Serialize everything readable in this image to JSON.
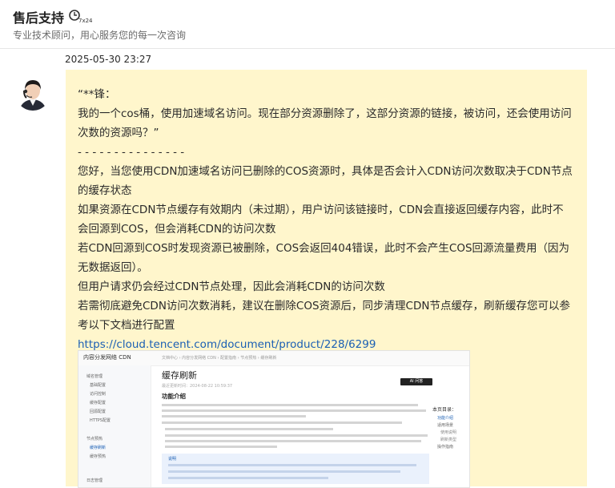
{
  "header": {
    "title": "售后支持",
    "badge_text": "7x24",
    "subtitle": "专业技术顾问，用心服务您的每一次咨询"
  },
  "message": {
    "timestamp": "2025-05-30 23:27",
    "lines": [
      "“**锋：",
      "我的一个cos桶，使用加速域名访问。现在部分资源删除了，这部分资源的链接，被访问，还会使用访问次数的资源吗？”",
      "- - - - - - - - - - - - - - -",
      "您好，当您使用CDN加速域名访问已删除的COS资源时，具体是否会计入CDN访问次数取决于CDN节点的缓存状态",
      "如果资源在CDN节点缓存有效期内（未过期），用户访问该链接时，CDN会直接返回缓存内容，此时不会回源到COS，但会消耗CDN的访问次数",
      "若CDN回源到COS时发现资源已被删除，COS会返回404错误，此时不会产生COS回源流量费用（因为无数据返回）。",
      "但用户请求仍会经过CDN节点处理，因此会消耗CDN的访问次数",
      "若需彻底避免CDN访问次数消耗，建议在删除COS资源后，同步清理CDN节点缓存，刷新缓存您可以参考以下文档进行配置"
    ],
    "link": "https://cloud.tencent.com/document/product/228/6299"
  },
  "doc_preview": {
    "brand": "内容分发网络 CDN",
    "breadcrumb": "文档中心 › 内容分发网络 CDN › 配置指南 › 节点预热 › 缓存刷新",
    "title": "缓存刷新",
    "date": "最近更新时间：2024-08-22 10:59:37",
    "ask_button": "AI 问答",
    "section": "功能介绍",
    "note_title": "说明",
    "toc_title": "本页目录：",
    "toc_items": [
      "功能介绍",
      "适用场景",
      "使用说明",
      "刷新类型",
      "操作指南"
    ],
    "side_items": [
      "域名管理",
      "基础配置",
      "访问控制",
      "缓存配置",
      "回源配置",
      "HTTPS配置",
      "节点预热",
      "缓存刷新",
      "缓存预热",
      "日志管理"
    ]
  },
  "colors": {
    "bubble": "#fff6cc",
    "link": "#1a5fb4"
  }
}
